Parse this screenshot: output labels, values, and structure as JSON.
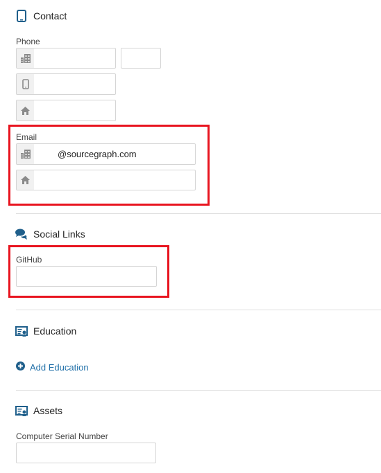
{
  "contact": {
    "title": "Contact",
    "phone_label": "Phone",
    "phone_work": "",
    "phone_ext": "",
    "phone_mobile": "",
    "phone_home": "",
    "email_label": "Email",
    "email_work": "@sourcegraph.com",
    "email_home": ""
  },
  "social": {
    "title": "Social Links",
    "github_label": "GitHub",
    "github_value": ""
  },
  "education": {
    "title": "Education",
    "add_label": "Add Education"
  },
  "assets": {
    "title": "Assets",
    "serial_label": "Computer Serial Number",
    "serial_value": ""
  },
  "colors": {
    "accent": "#1f5f8b",
    "link": "#1f6fa8",
    "highlight": "#e8141f"
  }
}
